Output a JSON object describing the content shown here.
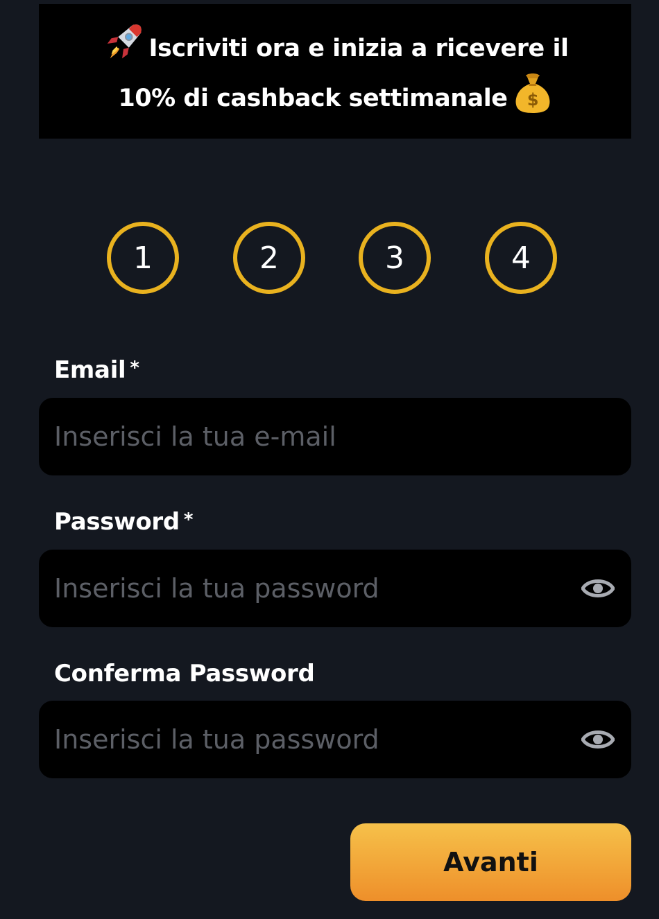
{
  "banner": {
    "line1": "Iscriviti ora e inizia a ricevere il",
    "line2": "10% di cashback settimanale",
    "leading_icon": "rocket-icon",
    "trailing_icon": "money-bag-icon"
  },
  "steps": [
    "1",
    "2",
    "3",
    "4"
  ],
  "form": {
    "email": {
      "label": "Email",
      "required_mark": "*",
      "placeholder": "Inserisci la tua e-mail",
      "value": ""
    },
    "password": {
      "label": "Password",
      "required_mark": "*",
      "placeholder": "Inserisci la tua password",
      "value": "",
      "toggle_icon": "eye-icon"
    },
    "confirm_password": {
      "label": "Conferma Password",
      "placeholder": "Inserisci la tua password",
      "value": "",
      "toggle_icon": "eye-icon"
    }
  },
  "submit": {
    "label": "Avanti"
  },
  "colors": {
    "background": "#141820",
    "panel": "#000000",
    "step_ring": "#e9b21f",
    "button_top": "#f6c14a",
    "button_bottom": "#ee8f2a",
    "placeholder": "#5c5f66"
  }
}
